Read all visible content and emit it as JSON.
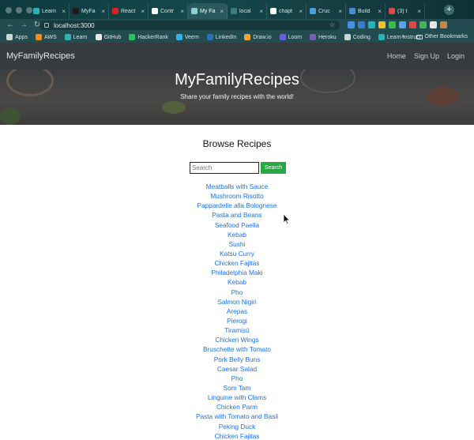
{
  "browser": {
    "tabs": [
      {
        "label": "Learn",
        "color": "#2bb3b6"
      },
      {
        "label": "MyFa",
        "color": "#1b1b1b"
      },
      {
        "label": "React",
        "color": "#e02020"
      },
      {
        "label": "Contr",
        "color": "#ffffff"
      },
      {
        "label": "My Fa",
        "color": "#8fd1d4",
        "active": true
      },
      {
        "label": "local",
        "color": "#3f7d80"
      },
      {
        "label": "chapt",
        "color": "#ffffff"
      },
      {
        "label": "Cruc",
        "color": "#4aa0d8"
      },
      {
        "label": "Build",
        "color": "#4a8ad8"
      },
      {
        "label": "(3) t",
        "color": "#e04848"
      }
    ],
    "new_tab": "+",
    "url": "localhost:3000",
    "bookmarks": [
      {
        "label": "Apps",
        "color": "#c8d8d8"
      },
      {
        "label": "AWS",
        "color": "#f08c1e"
      },
      {
        "label": "Learn",
        "color": "#2bb3b6"
      },
      {
        "label": "GitHub",
        "color": "#e9e9e9"
      },
      {
        "label": "HackerRank",
        "color": "#2fbf5a"
      },
      {
        "label": "Veem",
        "color": "#3ab0e8"
      },
      {
        "label": "LinkedIn",
        "color": "#2a6fb8"
      },
      {
        "label": "Draw.io",
        "color": "#f2a33a"
      },
      {
        "label": "Loom",
        "color": "#6b5ce7"
      },
      {
        "label": "Heroku",
        "color": "#7a5bb8"
      },
      {
        "label": "Coding",
        "color": "#c8d8d8"
      },
      {
        "label": "Learn Instruct",
        "color": "#2bb3b6"
      }
    ],
    "more_bookmarks": "»",
    "other_bookmarks": "Other Bookmarks",
    "extension_colors": [
      "#4a90e2",
      "#3a7bd5",
      "#2bb3b6",
      "#f2c12e",
      "#3fb950",
      "#5aa0f0",
      "#e04848",
      "#3fb950",
      "#e5e5e5",
      "#c68642"
    ]
  },
  "site": {
    "brand": "MyFamilyRecipes",
    "nav": [
      "Home",
      "Sign Up",
      "Login"
    ],
    "hero_title": "MyFamilyRecipes",
    "hero_subtitle": "Share your family recipes with the world!",
    "section_title": "Browse Recipes",
    "search_placeholder": "Search",
    "search_button": "Search",
    "recipes": [
      "Meatballs with Sauce",
      "Mushroom Risotto",
      "Pappardelle alla Bolognese",
      "Pasta and Beans",
      "Seafood Paella",
      "Kebab",
      "Sushi",
      "Katsu Curry",
      "Chicken Fajitas",
      "Philadelphia Maki",
      "Kebab",
      "Pho",
      "Salmon Nigiri",
      "Arepas",
      "Pierogi",
      "Tiramisù",
      "Chicken Wings",
      "Bruschette with Tomato",
      "Pork Belly Buns",
      "Caesar Salad",
      "Pho",
      "Som Tam",
      "Linguine with Clams",
      "Chicken Parm",
      "Pasta with Tomato and Basil",
      "Peking Duck",
      "Chicken Fajitas"
    ],
    "link_color": "#1a73e8",
    "button_color": "#28a745"
  }
}
